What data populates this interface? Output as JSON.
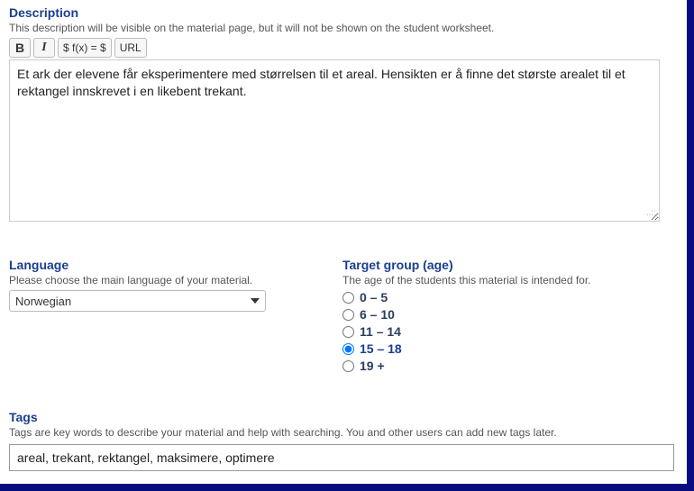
{
  "description": {
    "title": "Description",
    "hint": "This description will be visible on the material page, but it will not be shown on the student worksheet.",
    "toolbar": {
      "bold": "B",
      "italic": "I",
      "formula": "$ f(x) = $",
      "url": "URL"
    },
    "text": "Et ark der elevene får eksperimentere med størrelsen til et areal. Hensikten er å finne det største arealet til et rektangel innskrevet i en likebent trekant."
  },
  "language": {
    "title": "Language",
    "hint": "Please choose the main language of your material.",
    "selected": "Norwegian"
  },
  "target_group": {
    "title": "Target group (age)",
    "hint": "The age of the students this material is intended for.",
    "options": [
      {
        "label": "0 – 5",
        "selected": false
      },
      {
        "label": "6 – 10",
        "selected": false
      },
      {
        "label": "11 – 14",
        "selected": false
      },
      {
        "label": "15 – 18",
        "selected": true
      },
      {
        "label": "19 +",
        "selected": false
      }
    ]
  },
  "tags": {
    "title": "Tags",
    "hint": "Tags are key words to describe your material and help with searching. You and other users can add new tags later.",
    "value": "areal, trekant, rektangel, maksimere, optimere"
  }
}
